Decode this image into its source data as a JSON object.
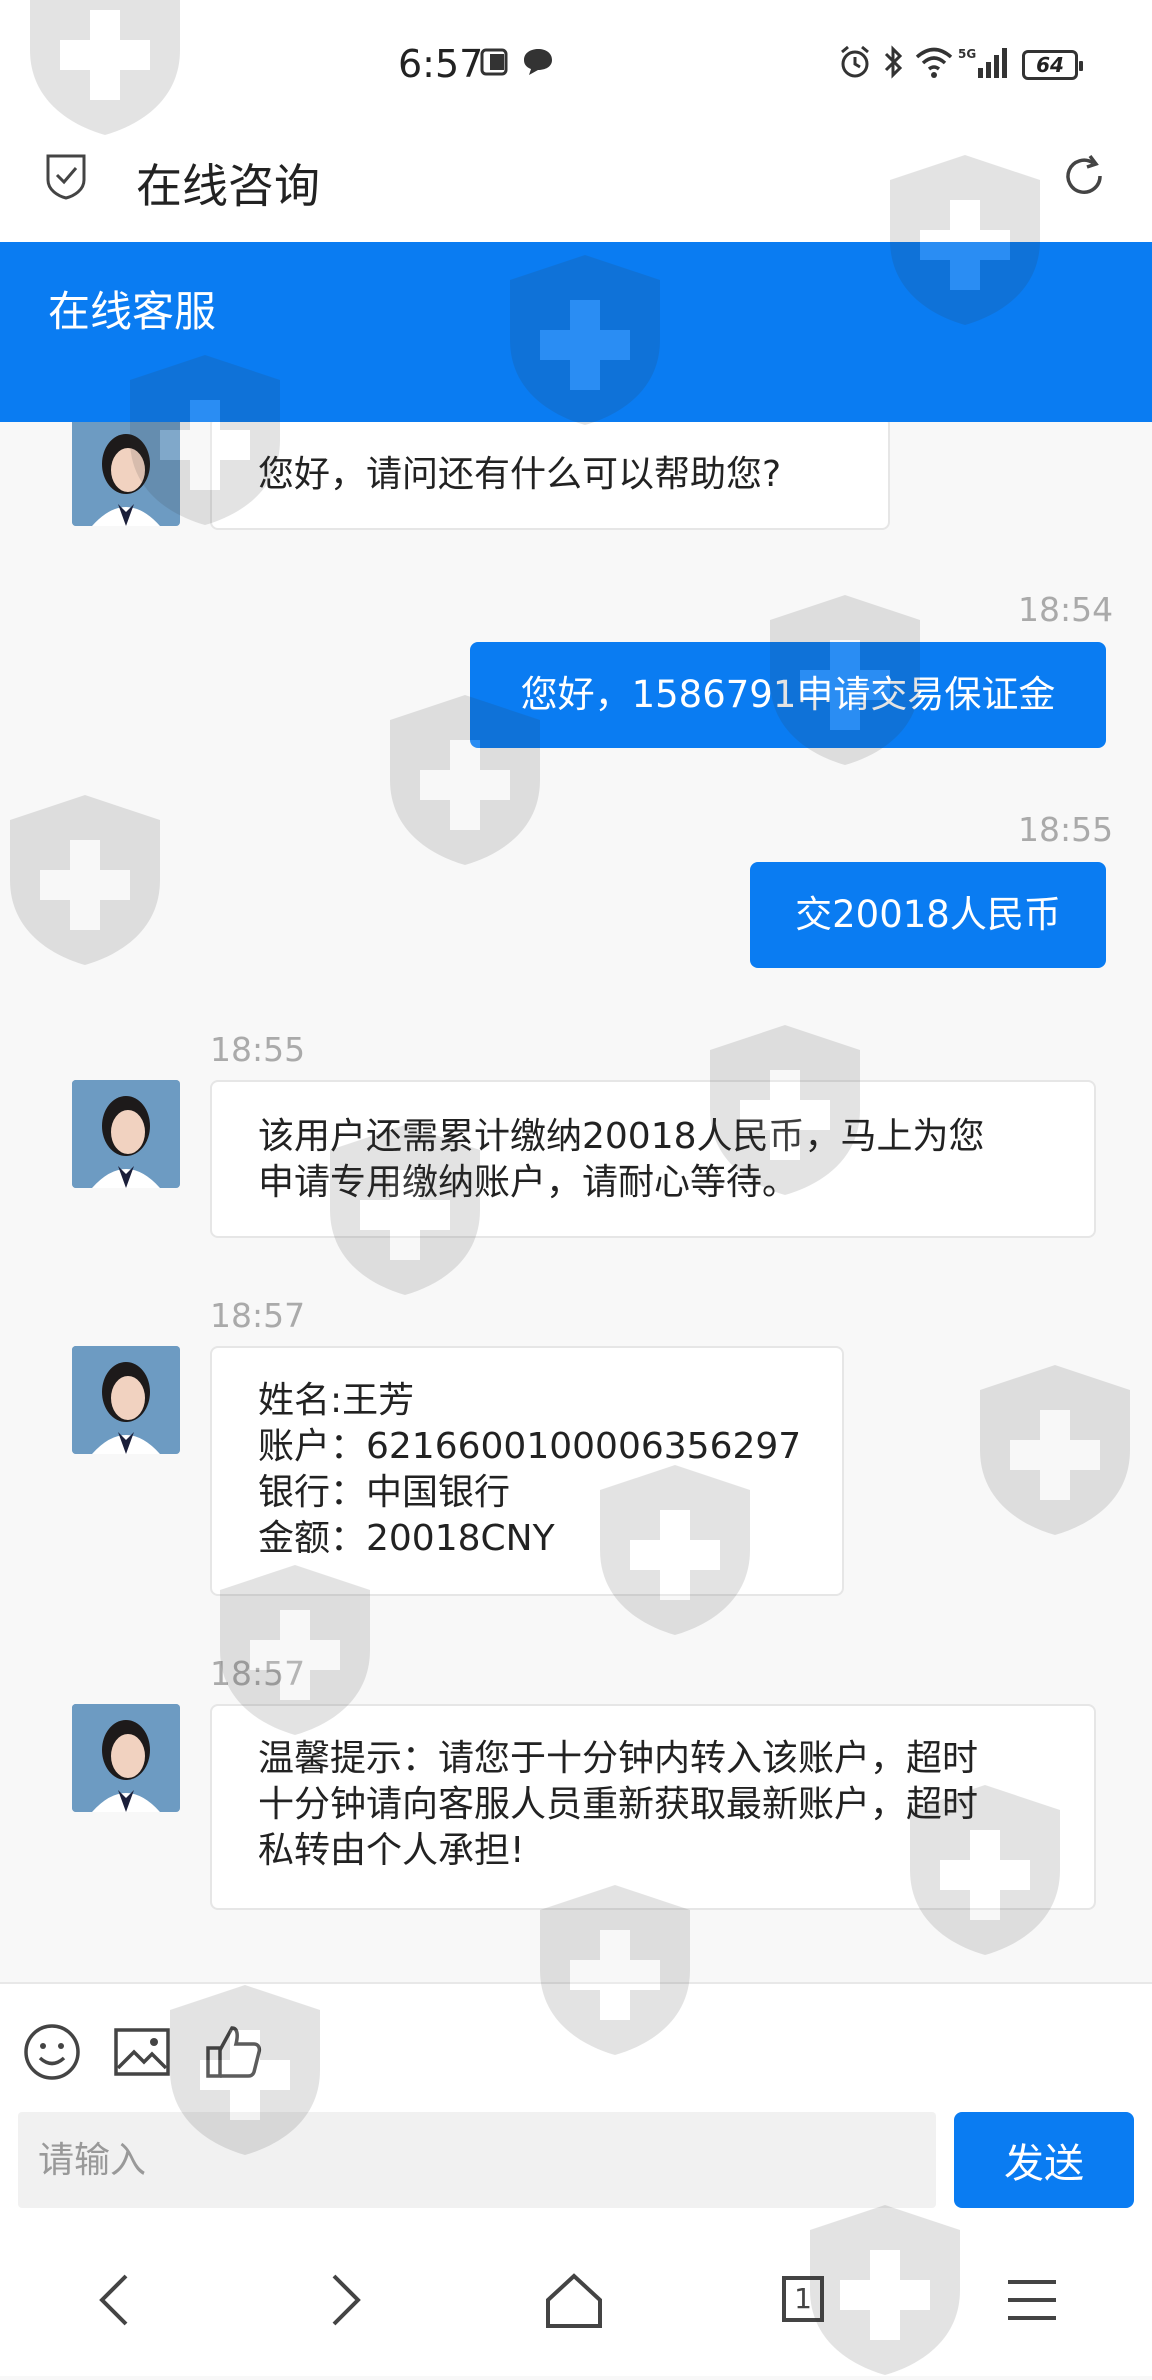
{
  "status_bar": {
    "time": "6:57",
    "network": "5G",
    "battery": "64"
  },
  "app": {
    "title": "在线咨询"
  },
  "banner": {
    "title": "在线客服"
  },
  "messages": [
    {
      "side": "in",
      "text": "您好，请问还有什么可以帮助您?"
    },
    {
      "side": "out",
      "time": "18:54",
      "text": "您好，1586791申请交易保证金"
    },
    {
      "side": "out",
      "time": "18:55",
      "text": "交20018人民币"
    },
    {
      "side": "in",
      "time": "18:55",
      "lines": [
        "该用户还需累计缴纳20018人民币，马上为您",
        "申请专用缴纳账户，请耐心等待。"
      ]
    },
    {
      "side": "in",
      "time": "18:57",
      "lines": [
        "姓名:王芳",
        "账户：6216600100006356297",
        "银行：中国银行",
        "金额：20018CNY"
      ]
    },
    {
      "side": "in",
      "time": "18:57",
      "lines": [
        "温馨提示：请您于十分钟内转入该账户，超时",
        "十分钟请向客服人员重新获取最新账户，超时",
        "私转由个人承担!"
      ]
    }
  ],
  "input": {
    "placeholder": "请输入",
    "send_label": "发送"
  },
  "nav": {
    "tab_count": "1"
  },
  "colors": {
    "accent": "#0a7cf2",
    "background": "#f8f8f8",
    "bubble_in": "#ffffff"
  },
  "icons": [
    "alarm-icon",
    "bluetooth-icon",
    "wifi-icon",
    "signal-icon",
    "battery-icon",
    "shield-check-icon",
    "refresh-icon",
    "emoji-icon",
    "image-icon",
    "thumbs-up-icon",
    "back-icon",
    "forward-icon",
    "home-icon",
    "tabs-icon",
    "menu-icon"
  ]
}
